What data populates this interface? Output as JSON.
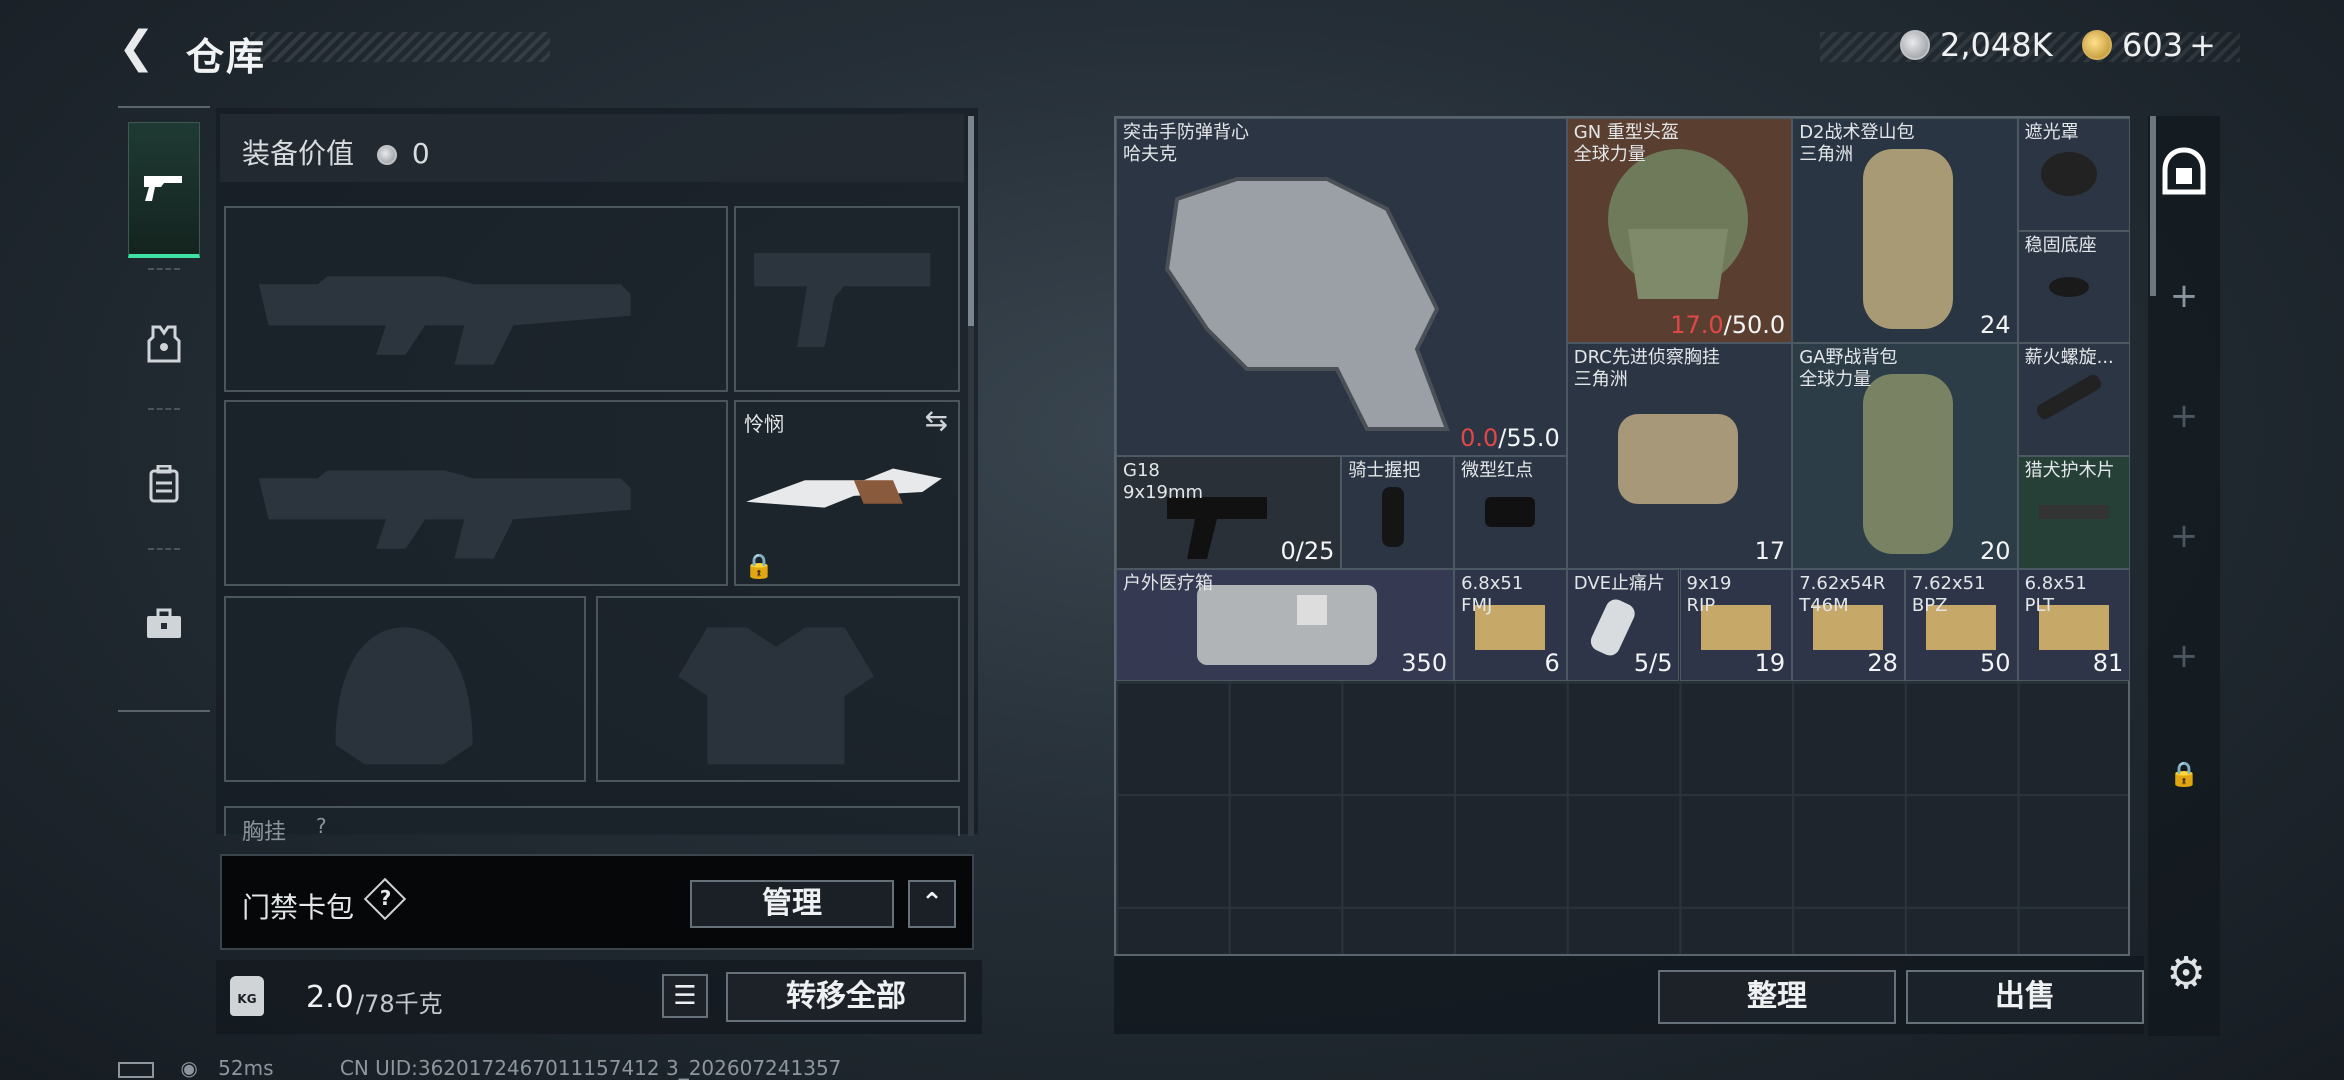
{
  "header": {
    "back_icon": "chevron-left-icon",
    "title": "仓库"
  },
  "currency": {
    "silver": "2,048K",
    "gold": "603",
    "gold_plus": "+"
  },
  "side_tabs": [
    {
      "name": "firearm-tab",
      "icon": "pistol-icon",
      "active": true
    },
    {
      "name": "armor-tab",
      "icon": "vest-icon",
      "active": false
    },
    {
      "name": "backpack-tab",
      "icon": "backpack-icon",
      "active": false
    },
    {
      "name": "toolbox-tab",
      "icon": "toolbox-icon",
      "active": false
    }
  ],
  "loadout": {
    "value_label": "装备价值",
    "value": "0",
    "melee_name": "怜悯",
    "next_section": "胸挂",
    "next_section_help": "?"
  },
  "keycard": {
    "label": "门禁卡包",
    "help": "?",
    "manage_label": "管理",
    "collapse_icon": "chevron-up-icon"
  },
  "weight": {
    "current": "2.0",
    "max": "/78千克"
  },
  "transfer_all_label": "转移全部",
  "stash_items": [
    {
      "name": "突击手防弹背心\n哈夫克",
      "count_red": "0.0",
      "count": "/55.0"
    },
    {
      "name": "GN 重型头盔\n全球力量",
      "count_red": "17.0",
      "count": "/50.0"
    },
    {
      "name": "D2战术登山包\n三角洲",
      "count": "24"
    },
    {
      "name": "遮光罩",
      "count": ""
    },
    {
      "name": "稳固底座",
      "count": ""
    },
    {
      "name": "DRC先进侦察胸挂\n三角洲",
      "count": "17"
    },
    {
      "name": "GA野战背包\n全球力量",
      "count": "20"
    },
    {
      "name": "薪火螺旋...",
      "count": ""
    },
    {
      "name": "G18\n9x19mm",
      "count": "0/25"
    },
    {
      "name": "骑士握把",
      "count": ""
    },
    {
      "name": "微型红点",
      "count": ""
    },
    {
      "name": "猎犬护木片",
      "count": ""
    },
    {
      "name": "户外医疗箱",
      "count": "350"
    },
    {
      "name": "6.8x51\nFMJ",
      "count": "6"
    },
    {
      "name": "DVE止痛片",
      "count": "5/5"
    },
    {
      "name": "9x19\nRIP",
      "count": "19"
    },
    {
      "name": "7.62x54R\nT46M",
      "count": "28"
    },
    {
      "name": "7.62x51\nBPZ",
      "count": "50"
    },
    {
      "name": "6.8x51\nPLT",
      "count": "81"
    }
  ],
  "stash_buttons": {
    "sort": "整理",
    "sell": "出售"
  },
  "right_rail": {
    "top_icon": "stash-icon",
    "add": "+",
    "lock_icon": "lock-icon",
    "settings_icon": "gear-icon"
  },
  "status": {
    "ping": "52ms",
    "uid": "CN UID:3620172467011157412 3_202607241357"
  },
  "colors": {
    "accent": "#3ee0a4",
    "warn": "#e04848"
  }
}
